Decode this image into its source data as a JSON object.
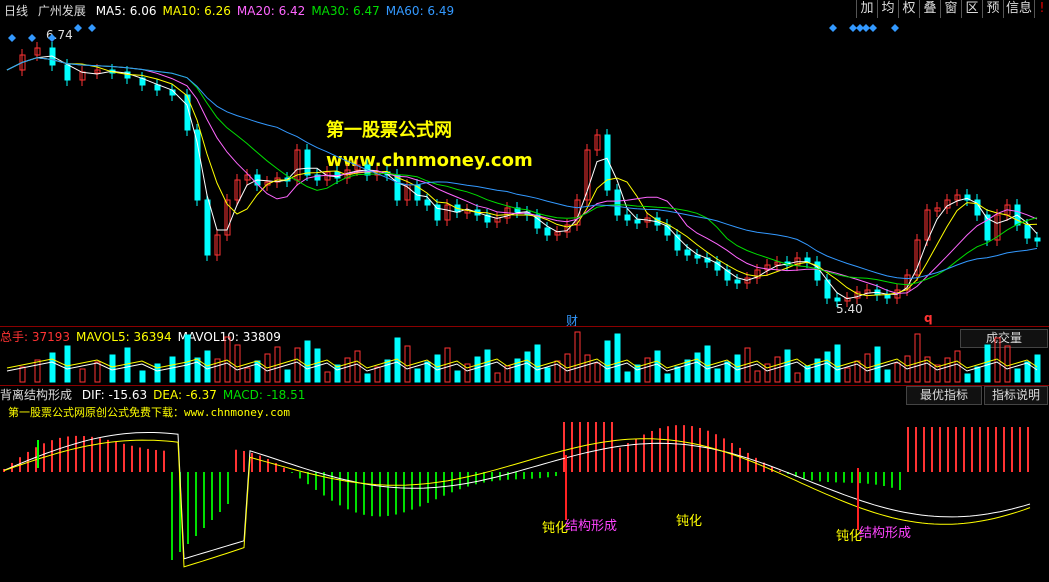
{
  "main_panel": {
    "period": "日线",
    "stock_name": "广州发展",
    "ma_legend": [
      {
        "label": "MA5:",
        "value": "6.06",
        "color": "#ffffff"
      },
      {
        "label": "MA10:",
        "value": "6.26",
        "color": "#ffff00"
      },
      {
        "label": "MA20:",
        "value": "6.42",
        "color": "#ff66ff"
      },
      {
        "label": "MA30:",
        "value": "6.47",
        "color": "#00dd00"
      },
      {
        "label": "MA60:",
        "value": "6.49",
        "color": "#3399ff"
      }
    ],
    "high_label": "6.74",
    "low_label": "5.40",
    "event_label": "财",
    "q_label": "q",
    "watermark_title": "第一股票公式网",
    "watermark_url": "www.chnmoney.com"
  },
  "toolbar": {
    "buttons": [
      "加",
      "均",
      "权",
      "叠",
      "窗",
      "区",
      "预",
      "信息"
    ]
  },
  "volume_panel": {
    "legend": [
      {
        "label": "总手:",
        "value": "37193",
        "color": "#ff3333"
      },
      {
        "label": "MAVOL5:",
        "value": "36394",
        "color": "#ffff00"
      },
      {
        "label": "MAVOL10:",
        "value": "33809",
        "color": "#ffffff"
      }
    ],
    "indicator_button": "成交量"
  },
  "macd_panel": {
    "title": "背离结构形成",
    "legend": [
      {
        "label": "DIF:",
        "value": "-15.63",
        "color": "#ffffff"
      },
      {
        "label": "DEA:",
        "value": "-6.37",
        "color": "#ffff00"
      },
      {
        "label": "MACD:",
        "value": "-18.51",
        "color": "#00dd00"
      }
    ],
    "promo_text": "第一股票公式网原创公式免费下载：www.chnmoney.com",
    "best_button": "最优指标",
    "explain_button": "指标说明",
    "annotations": {
      "dunhua_1": "钝化",
      "jiegou_1": "结构形成",
      "dunhua_2": "钝化",
      "dunhua_3": "钝化",
      "jiegou_2": "结构形成"
    }
  },
  "colors": {
    "up": "#ff3333",
    "down": "#00ffff",
    "grid_border": "#8b0000"
  }
}
